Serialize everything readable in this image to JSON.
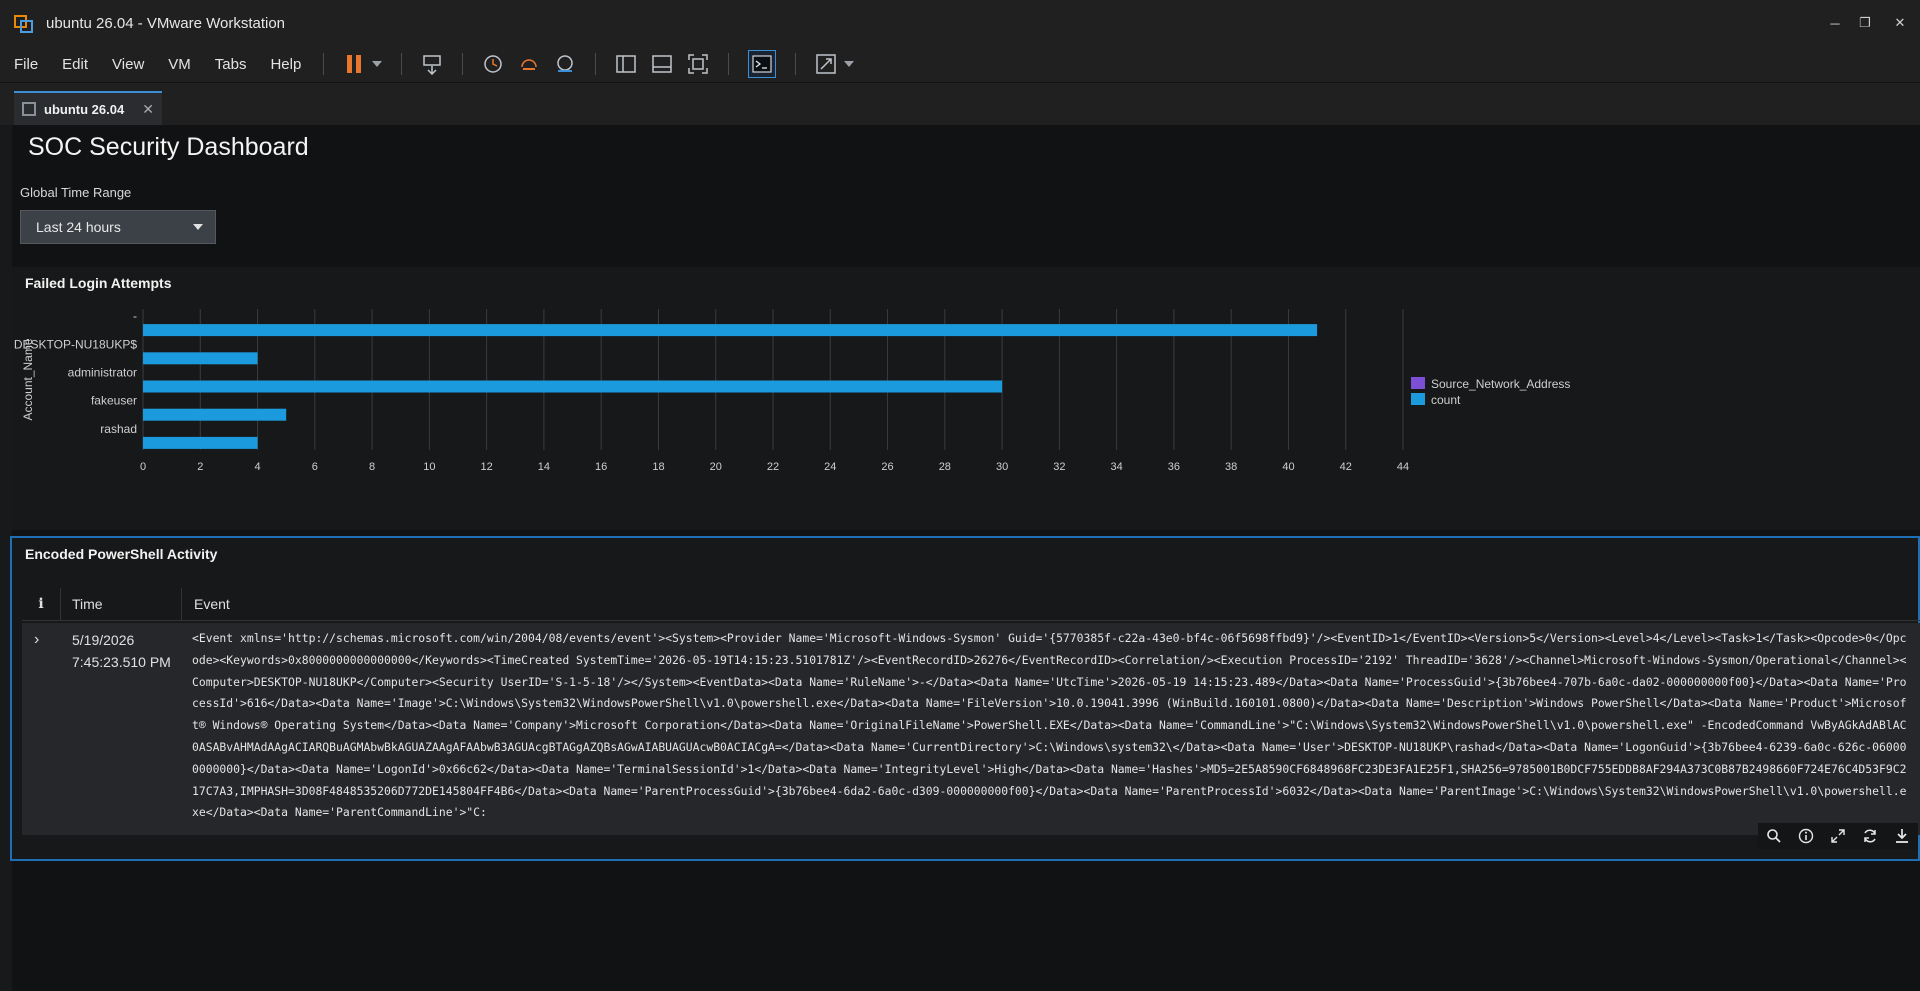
{
  "window": {
    "title": "ubuntu 26.04 - VMware Workstation",
    "controls": {
      "minimize": "─",
      "restore": "❐",
      "close": "✕"
    }
  },
  "menu": {
    "items": [
      "File",
      "Edit",
      "View",
      "VM",
      "Tabs",
      "Help"
    ]
  },
  "tabs": [
    {
      "label": "ubuntu 26.04",
      "close": "✕"
    }
  ],
  "dashboard": {
    "title": "SOC Security Dashboard",
    "time_range": {
      "label": "Global Time Range",
      "value": "Last 24 hours"
    }
  },
  "panel_failed_logins": {
    "title": "Failed Login Attempts"
  },
  "chart_data": {
    "type": "bar",
    "orientation": "horizontal",
    "categories": [
      "-",
      "DESKTOP-NU18UKP$",
      "administrator",
      "fakeuser",
      "rashad"
    ],
    "series": [
      {
        "name": "Source_Network_Address",
        "values": [
          0,
          0,
          0,
          0,
          0
        ],
        "color": "#7b4fd6"
      },
      {
        "name": "count",
        "values": [
          41,
          4,
          30,
          5,
          4
        ],
        "color": "#1c9ade"
      }
    ],
    "ylabel": "Account_Name",
    "xlim": [
      0,
      44
    ],
    "xticks": [
      0,
      2,
      4,
      6,
      8,
      10,
      12,
      14,
      16,
      18,
      20,
      22,
      24,
      26,
      28,
      30,
      32,
      34,
      36,
      38,
      40,
      42,
      44
    ],
    "grid": true,
    "legend": "right"
  },
  "panel_powershell": {
    "title": "Encoded PowerShell Activity",
    "columns": {
      "info": "i",
      "time": "Time",
      "event": "Event"
    },
    "rows": [
      {
        "expand": "›",
        "time_date": "5/19/2026",
        "time_clock": "7:45:23.510 PM",
        "event": "<Event xmlns='http://schemas.microsoft.com/win/2004/08/events/event'><System><Provider Name='Microsoft-Windows-Sysmon' Guid='{5770385f-c22a-43e0-bf4c-06f5698ffbd9}'/><EventID>1</EventID><Version>5</Version><Level>4</Level><Task>1</Task><Opcode>0</Opcode><Keywords>0x8000000000000000</Keywords><TimeCreated SystemTime='2026-05-19T14:15:23.5101781Z'/><EventRecordID>26276</EventRecordID><Correlation/><Execution ProcessID='2192' ThreadID='3628'/><Channel>Microsoft-Windows-Sysmon/Operational</Channel><Computer>DESKTOP-NU18UKP</Computer><Security UserID='S-1-5-18'/></System><EventData><Data Name='RuleName'>-</Data><Data Name='UtcTime'>2026-05-19 14:15:23.489</Data><Data Name='ProcessGuid'>{3b76bee4-707b-6a0c-da02-000000000f00}</Data><Data Name='ProcessId'>616</Data><Data Name='Image'>C:\\Windows\\System32\\WindowsPowerShell\\v1.0\\powershell.exe</Data><Data Name='FileVersion'>10.0.19041.3996 (WinBuild.160101.0800)</Data><Data Name='Description'>Windows PowerShell</Data><Data Name='Product'>Microsoft® Windows® Operating System</Data><Data Name='Company'>Microsoft Corporation</Data><Data Name='OriginalFileName'>PowerShell.EXE</Data><Data Name='CommandLine'>\"C:\\Windows\\System32\\WindowsPowerShell\\v1.0\\powershell.exe\" -EncodedCommand VwByAGkAdABlAC0ASABvAHMAdAAgACIARQBuAGMAbwBkAGUAZAAgAFAAbwB3AGUAcgBTAGgAZQBsAGwAIABUAGUAcwB0ACIACgA=</Data><Data Name='CurrentDirectory'>C:\\Windows\\system32\\</Data><Data Name='User'>DESKTOP-NU18UKP\\rashad</Data><Data Name='LogonGuid'>{3b76bee4-6239-6a0c-626c-060000000000}</Data><Data Name='LogonId'>0x66c62</Data><Data Name='TerminalSessionId'>1</Data><Data Name='IntegrityLevel'>High</Data><Data Name='Hashes'>MD5=2E5A8590CF6848968FC23DE3FA1E25F1,SHA256=9785001B0DCF755EDDB8AF294A373C0B87B2498660F724E76C4D53F9C217C7A3,IMPHASH=3D08F4848535206D772DE145804FF4B6</Data><Data Name='ParentProcessGuid'>{3b76bee4-6da2-6a0c-d309-000000000f00}</Data><Data Name='ParentProcessId'>6032</Data><Data Name='ParentImage'>C:\\Windows\\System32\\WindowsPowerShell\\v1.0\\powershell.exe</Data><Data Name='ParentCommandLine'>\"C:"
      }
    ]
  }
}
